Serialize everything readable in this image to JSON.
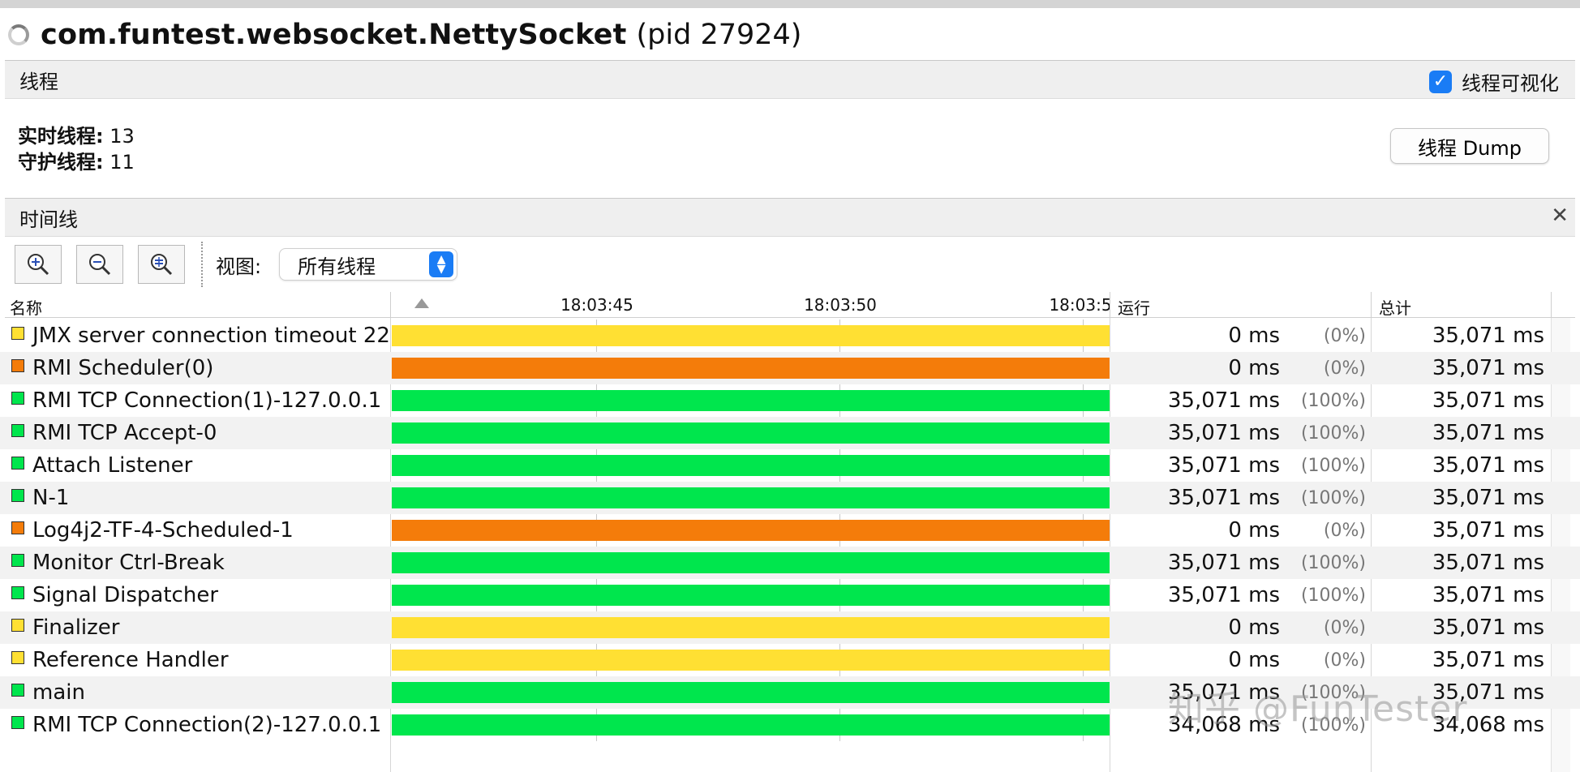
{
  "window": {
    "app_name": "com.funtest.websocket.NettySocket",
    "pid_text": "(pid 27924)"
  },
  "threads_panel": {
    "header": "线程",
    "visualize_label": "线程可视化",
    "visualize_checked": true,
    "live_label": "实时线程:",
    "live_value": "13",
    "daemon_label": "守护线程:",
    "daemon_value": "11",
    "dump_button": "线程 Dump"
  },
  "timeline": {
    "header": "时间线",
    "close_icon": "close-icon",
    "zoom_buttons": [
      "zoom-in-icon",
      "zoom-out-icon",
      "zoom-fit-icon"
    ],
    "view_label": "视图:",
    "view_selected": "所有线程",
    "columns": {
      "name": "名称",
      "running": "运行",
      "total": "总计"
    },
    "ticks": [
      "18:03:45",
      "18:03:50",
      "18:03:5"
    ],
    "state_colors": {
      "running": "#00e64d",
      "waiting": "#ffe033",
      "park": "#f47c0a"
    },
    "rows": [
      {
        "name": "JMX server connection timeout 22",
        "state": "waiting",
        "run": "0 ms",
        "pct": "(0%)",
        "total": "35,071 ms"
      },
      {
        "name": "RMI Scheduler(0)",
        "state": "park",
        "run": "0 ms",
        "pct": "(0%)",
        "total": "35,071 ms"
      },
      {
        "name": "RMI TCP Connection(1)-127.0.0.1",
        "state": "running",
        "run": "35,071 ms",
        "pct": "(100%)",
        "total": "35,071 ms"
      },
      {
        "name": "RMI TCP Accept-0",
        "state": "running",
        "run": "35,071 ms",
        "pct": "(100%)",
        "total": "35,071 ms"
      },
      {
        "name": "Attach Listener",
        "state": "running",
        "run": "35,071 ms",
        "pct": "(100%)",
        "total": "35,071 ms"
      },
      {
        "name": "N-1",
        "state": "running",
        "run": "35,071 ms",
        "pct": "(100%)",
        "total": "35,071 ms"
      },
      {
        "name": "Log4j2-TF-4-Scheduled-1",
        "state": "park",
        "run": "0 ms",
        "pct": "(0%)",
        "total": "35,071 ms"
      },
      {
        "name": "Monitor Ctrl-Break",
        "state": "running",
        "run": "35,071 ms",
        "pct": "(100%)",
        "total": "35,071 ms"
      },
      {
        "name": "Signal Dispatcher",
        "state": "running",
        "run": "35,071 ms",
        "pct": "(100%)",
        "total": "35,071 ms"
      },
      {
        "name": "Finalizer",
        "state": "waiting",
        "run": "0 ms",
        "pct": "(0%)",
        "total": "35,071 ms"
      },
      {
        "name": "Reference Handler",
        "state": "waiting",
        "run": "0 ms",
        "pct": "(0%)",
        "total": "35,071 ms"
      },
      {
        "name": "main",
        "state": "running",
        "run": "35,071 ms",
        "pct": "(100%)",
        "total": "35,071 ms"
      },
      {
        "name": "RMI TCP Connection(2)-127.0.0.1",
        "state": "running",
        "run": "34,068 ms",
        "pct": "(100%)",
        "total": "34,068 ms"
      }
    ]
  },
  "watermark": "知乎 @FunTester"
}
